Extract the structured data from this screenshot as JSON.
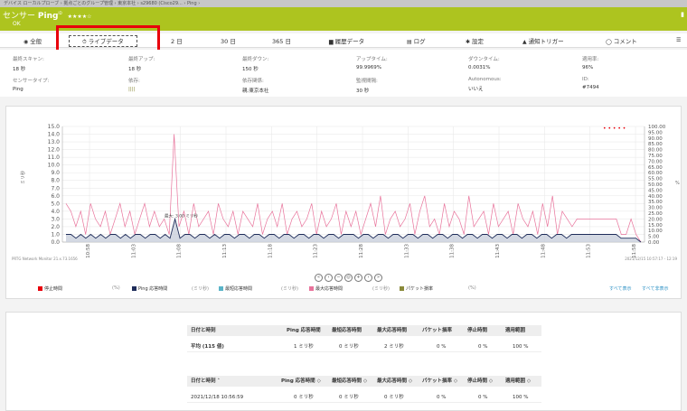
{
  "breadcrumb": "デバイス  ローカルプローブ  ›  拠点ごとのグループ管理  ›  東京本社  ›  s29680  (Cisco29...  ›  Ping  ›",
  "header": {
    "title_prefix": "センサー",
    "title_name": "Ping",
    "title_sup": "ID",
    "stars": "★★★★☆",
    "status": "OK",
    "pause_icon": "pause-icon"
  },
  "tabs": [
    {
      "label": "全般",
      "icon": "◉"
    },
    {
      "label": "ライブデータ",
      "icon": "⏱"
    },
    {
      "label": "2 日",
      "icon": ""
    },
    {
      "label": "30 日",
      "icon": ""
    },
    {
      "label": "365 日",
      "icon": ""
    },
    {
      "label": "履歴データ",
      "icon": "▆"
    },
    {
      "label": "ログ",
      "icon": "▤"
    },
    {
      "label": "設定",
      "icon": "✱"
    },
    {
      "label": "通知トリガー",
      "icon": "▲"
    },
    {
      "label": "コメント",
      "icon": "◯"
    },
    {
      "label": "",
      "icon": "☰"
    }
  ],
  "info": {
    "row1": [
      {
        "label": "最終スキャン:",
        "value": "18 秒"
      },
      {
        "label": "最終アップ:",
        "value": "18 秒"
      },
      {
        "label": "最終ダウン:",
        "value": "150 秒"
      },
      {
        "label": "アップタイム:",
        "value": "99.9969%"
      },
      {
        "label": "ダウンタイム:",
        "value": "0.0031%"
      },
      {
        "label": "適用率:",
        "value": "96%"
      }
    ],
    "row2": [
      {
        "label": "センサータイプ:",
        "value": "Ping"
      },
      {
        "label": "依存:",
        "value": "||||"
      },
      {
        "label": "依存関係:",
        "value": "親:東京本社"
      },
      {
        "label": "監視間隔:",
        "value": "30 秒"
      },
      {
        "label": "Autonomous:",
        "value": "いいえ"
      },
      {
        "label": "ID:",
        "value": "#7494"
      }
    ]
  },
  "chart_data": {
    "type": "line",
    "left_axis": {
      "label": "ミリ秒",
      "ticks": [
        "0.0",
        "1.0",
        "2.0",
        "3.0",
        "4.0",
        "5.0",
        "6.0",
        "7.0",
        "8.0",
        "9.0",
        "10.0",
        "11.0",
        "12.0",
        "13.0",
        "14.0",
        "15.0"
      ],
      "ylim": [
        0,
        15
      ]
    },
    "right_axis": {
      "label": "%",
      "ticks": [
        "0.00",
        "5.00",
        "10.00",
        "15.00",
        "20.00",
        "25.00",
        "30.00",
        "35.00",
        "40.00",
        "45.00",
        "50.00",
        "55.00",
        "60.00",
        "65.00",
        "70.00",
        "75.00",
        "80.00",
        "85.00",
        "90.00",
        "95.00",
        "100.00"
      ],
      "ylim": [
        0,
        100
      ]
    },
    "x_ticks": [
      "10:58",
      "11:03",
      "11:08",
      "11:13",
      "11:18",
      "11:23",
      "11:28",
      "11:33",
      "11:38",
      "11:43",
      "11:48",
      "11:53",
      "11:58"
    ],
    "series": [
      {
        "name": "最大応答時間",
        "color": "#e8739b",
        "values": [
          5,
          4,
          2,
          4,
          1,
          5,
          3,
          2,
          4,
          1,
          3,
          5,
          2,
          4,
          1,
          3,
          5,
          2,
          4,
          2,
          3,
          1,
          14,
          2,
          4,
          1,
          5,
          2,
          3,
          4,
          1,
          5,
          3,
          2,
          4,
          1,
          4,
          3,
          2,
          5,
          1,
          3,
          4,
          2,
          5,
          1,
          3,
          4,
          2,
          3,
          5,
          1,
          4,
          2,
          3,
          5,
          1,
          4,
          2,
          4,
          1,
          3,
          5,
          2,
          6,
          1,
          3,
          4,
          2,
          3,
          5,
          1,
          4,
          6,
          2,
          3,
          1,
          5,
          2,
          4,
          3,
          1,
          6,
          2,
          3,
          4,
          1,
          5,
          2,
          3,
          4,
          1,
          5,
          3,
          2,
          4,
          1,
          5,
          2,
          6,
          1,
          4,
          3,
          2,
          3,
          3,
          3,
          3,
          3,
          3,
          3,
          3,
          3,
          1,
          1,
          3,
          1,
          0
        ]
      },
      {
        "name": "Ping 応答時間",
        "color": "#1f2d5a",
        "values": [
          1,
          1,
          0.5,
          1,
          0.5,
          1,
          0.5,
          1,
          0.5,
          1,
          1,
          0.5,
          1,
          0.5,
          1,
          1,
          0.5,
          1,
          1,
          0.5,
          1,
          0.5,
          3,
          0.5,
          1,
          1,
          0.5,
          1,
          1,
          0.5,
          1,
          0.5,
          1,
          1,
          0.5,
          1,
          1,
          0.5,
          1,
          1,
          0.5,
          1,
          1,
          0.5,
          1,
          1,
          0.5,
          1,
          1,
          0.5,
          1,
          1,
          0.5,
          1,
          1,
          0.5,
          1,
          1,
          1,
          0.5,
          1,
          1,
          0.5,
          1,
          1,
          0.5,
          1,
          1,
          0.5,
          1,
          1,
          0.5,
          1,
          1,
          0.5,
          1,
          1,
          0.5,
          1,
          1,
          0.5,
          1,
          1,
          0.5,
          1,
          1,
          0.5,
          1,
          1,
          0.5,
          1,
          1,
          0.5,
          1,
          1,
          0.5,
          1,
          1,
          0.5,
          1,
          1,
          0.5,
          1,
          1,
          1,
          1,
          1,
          1,
          1,
          1,
          1,
          1,
          0.5,
          0.5,
          0.5,
          0.5,
          0
        ]
      }
    ],
    "annotation": "最大: 3.00 ミリ秒",
    "footer_left": "PRTG Network Monitor 21.x.73.1656",
    "footer_right": "2021/12/15 10:57:17 - 12:19",
    "red_markers": "• • • • •"
  },
  "legend": {
    "items": [
      {
        "label": "停止時間",
        "unit": "(%)",
        "color": "#e8000b"
      },
      {
        "label": "Ping 応答時間",
        "unit": "(ミリ秒)",
        "color": "#1f2d5a"
      },
      {
        "label": "最短応答時間",
        "unit": "(ミリ秒)",
        "color": "#5ab4c8"
      },
      {
        "label": "最大応答時間",
        "unit": "(ミリ秒)",
        "color": "#e8739b"
      },
      {
        "label": "パケット損率",
        "unit": "(%)",
        "color": "#8a8a3a"
      }
    ],
    "show_all": "すべて表示",
    "hide_all": "すべて非表示"
  },
  "nav_buttons": [
    "«",
    "‹",
    "−",
    "◎",
    "+",
    "›",
    "»"
  ],
  "summary_table": {
    "headers": [
      "日付と時刻",
      "Ping 応答時間",
      "最短応答時間",
      "最大応答時間",
      "パケット損率",
      "停止時間",
      "適用範囲"
    ],
    "rows": [
      [
        "平均 (115 値)",
        "1 ミリ秒",
        "0 ミリ秒",
        "2 ミリ秒",
        "0 %",
        "0 %",
        "100 %"
      ]
    ]
  },
  "detail_table": {
    "headers": [
      "日付と時刻 ˄",
      "Ping 応答時間 ◇",
      "最短応答時間 ◇",
      "最大応答時間 ◇",
      "パケット損率 ◇",
      "停止時間 ◇",
      "適用範囲 ◇"
    ],
    "rows": [
      [
        "2021/12/18 10:56:59",
        "0 ミリ秒",
        "0 ミリ秒",
        "0 ミリ秒",
        "0 %",
        "0 %",
        "100 %"
      ]
    ]
  }
}
